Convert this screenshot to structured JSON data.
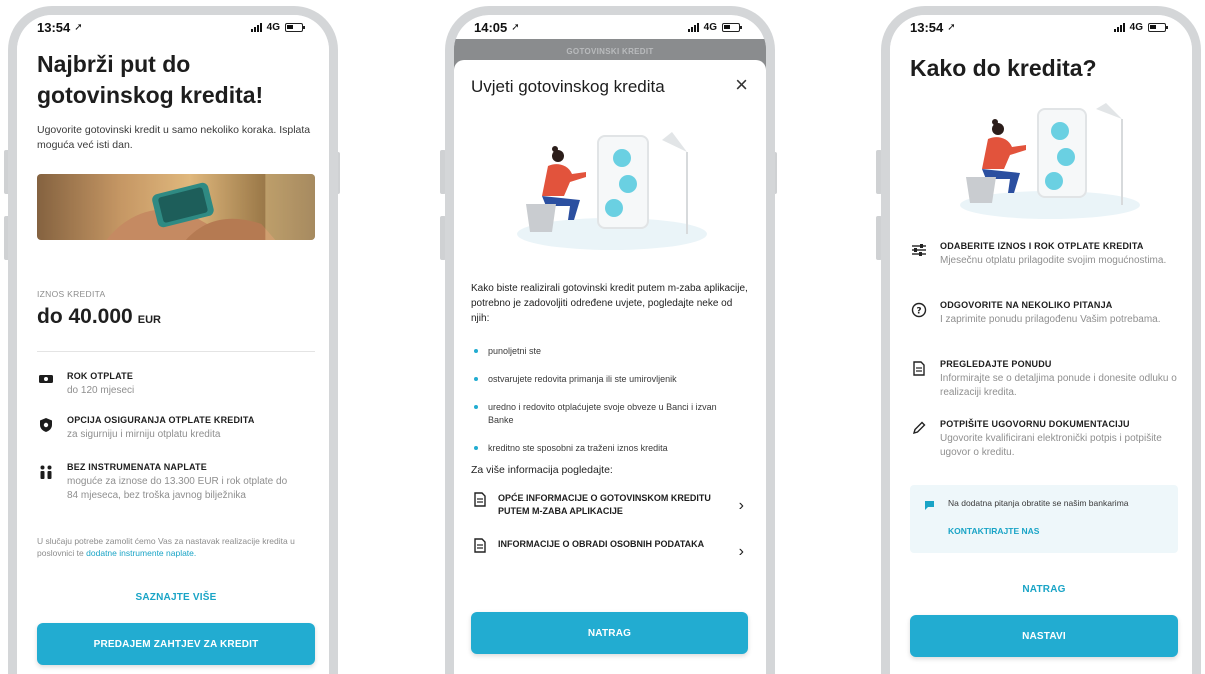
{
  "screen1": {
    "status": {
      "time": "13:54",
      "network": "4G"
    },
    "title": "Najbrži put do gotovinskog kredita!",
    "intro": "Ugovorite gotovinski kredit u samo nekoliko koraka. Isplata moguća već isti dan.",
    "amount_label": "IZNOS KREDITA",
    "amount_value": "do 40.000",
    "amount_currency": "EUR",
    "features": [
      {
        "icon": "banknote-icon",
        "title": "ROK OTPLATE",
        "desc": "do 120 mjeseci"
      },
      {
        "icon": "shield-icon",
        "title": "OPCIJA OSIGURANJA OTPLATE KREDITA",
        "desc": "za sigurniju i mirniju otplatu kredita"
      },
      {
        "icon": "people-icon",
        "title": "BEZ INSTRUMENATA NAPLATE",
        "desc": "moguće za iznose do 13.300 EUR i rok otplate do 84 mjeseca, bez troška javnog bilježnika"
      }
    ],
    "footnote_text": "U slučaju potrebe zamolit ćemo Vas za nastavak realizacije kredita u poslovnici te",
    "footnote_link": "dodatne instrumente naplate.",
    "learn_more": "SAZNAJTE VIŠE",
    "cta": "PREDAJEM ZAHTJEV ZA KREDIT"
  },
  "screen2": {
    "status": {
      "time": "14:05",
      "network": "4G"
    },
    "behind_title": "GOTOVINSKI KREDIT",
    "modal_title": "Uvjeti gotovinskog kredita",
    "close": "×",
    "intro": "Kako biste realizirali gotovinski kredit putem m-zaba aplikacije, potrebno je zadovoljiti određene uvjete, pogledajte neke od njih:",
    "bullets": [
      "punoljetni ste",
      "ostvarujete redovita primanja ili ste umirovljenik",
      "uredno i redovito otplaćujete svoje obveze u Banci i izvan Banke",
      "kreditno ste sposobni za traženi iznos kredita"
    ],
    "more_info": "Za više informacija pogledajte:",
    "docs": [
      "OPĆE INFORMACIJE O GOTOVINSKOM KREDITU PUTEM M-ZABA APLIKACIJE",
      "INFORMACIJE O OBRADI OSOBNIH PODATAKA"
    ],
    "back": "NATRAG"
  },
  "screen3": {
    "status": {
      "time": "13:54",
      "network": "4G"
    },
    "title": "Kako do kredita?",
    "steps": [
      {
        "icon": "sliders-icon",
        "title": "ODABERITE IZNOS I ROK OTPLATE KREDITA",
        "desc": "Mjesečnu otplatu prilagodite svojim mogućnostima."
      },
      {
        "icon": "question-icon",
        "title": "ODGOVORITE NA NEKOLIKO PITANJA",
        "desc": "I zaprimite ponudu prilagođenu Vašim potrebama."
      },
      {
        "icon": "document-icon",
        "title": "PREGLEDAJTE PONUDU",
        "desc": "Informirajte se o detaljima ponude i donesite odluku o realizaciji kredita."
      },
      {
        "icon": "pen-icon",
        "title": "POTPIŠITE UGOVORNU DOKUMENTACIJU",
        "desc": "Ugovorite kvalificirani elektronički potpis i potpišite ugovor o kreditu."
      }
    ],
    "contact_text": "Na dodatna pitanja obratite se našim bankarima",
    "contact_link": "KONTAKTIRAJTE NAS",
    "back": "NATRAG",
    "next": "NASTAVI"
  },
  "colors": {
    "accent": "#22acd1",
    "link": "#19a4c6",
    "frame": "#d4d6d8"
  }
}
